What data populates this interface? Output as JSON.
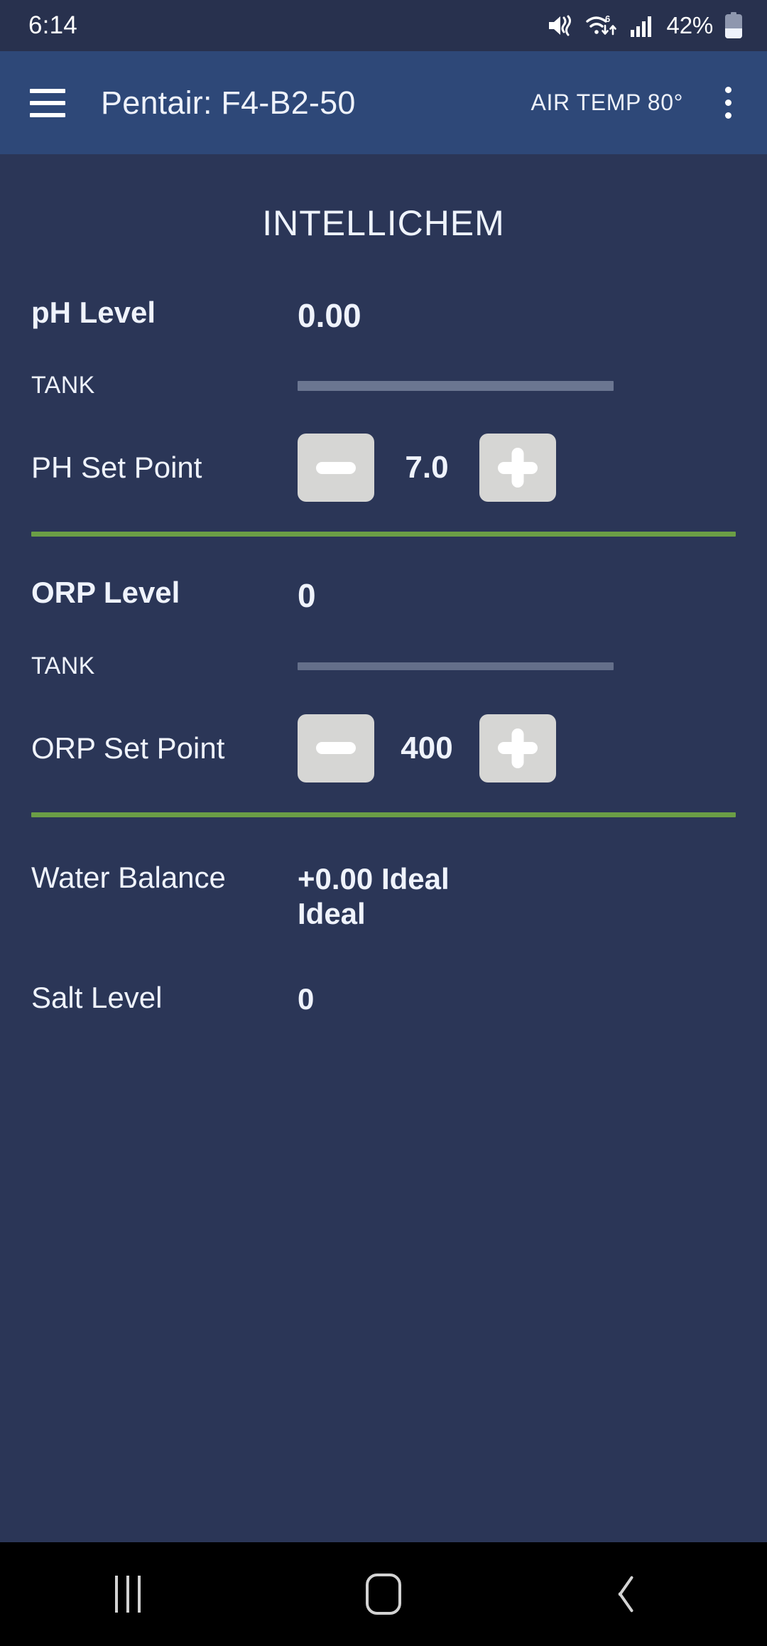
{
  "status_bar": {
    "time": "6:14",
    "battery_percent": "42%",
    "icons": [
      "mute-vibrate-icon",
      "wifi-6-icon",
      "cellular-signal-icon",
      "battery-icon"
    ]
  },
  "app_bar": {
    "menu_icon": "hamburger-menu-icon",
    "title": "Pentair: F4-B2-50",
    "air_temp": "AIR TEMP 80°",
    "overflow_icon": "overflow-menu-icon"
  },
  "page": {
    "title": "INTELLICHEM"
  },
  "sections": {
    "ph": {
      "level_label": "pH Level",
      "level_value": "0.00",
      "tank_label": "TANK",
      "tank_fill_percent": 100,
      "setpoint_label": "PH Set Point",
      "setpoint_value": "7.0",
      "decrease_label": "−",
      "increase_label": "+"
    },
    "orp": {
      "level_label": "ORP Level",
      "level_value": "0",
      "tank_label": "TANK",
      "tank_fill_percent": 100,
      "setpoint_label": "ORP Set Point",
      "setpoint_value": "400",
      "decrease_label": "−",
      "increase_label": "+"
    },
    "water_balance": {
      "label": "Water Balance",
      "value": "+0.00 Ideal Ideal"
    },
    "salt": {
      "label": "Salt Level",
      "value": "0"
    }
  },
  "nav_bar": {
    "recents_label": "recents-icon",
    "home_label": "home-icon",
    "back_label": "back-icon"
  },
  "colors": {
    "status_bar_bg": "#28314e",
    "app_bar_bg": "#2e4878",
    "body_bg": "#2b3657",
    "divider_green": "#6b9e46",
    "tank_bar": "#6b7691",
    "button_face": "#d6d6d4",
    "text": "#eff3fc",
    "nav_bar_bg": "#000000"
  }
}
